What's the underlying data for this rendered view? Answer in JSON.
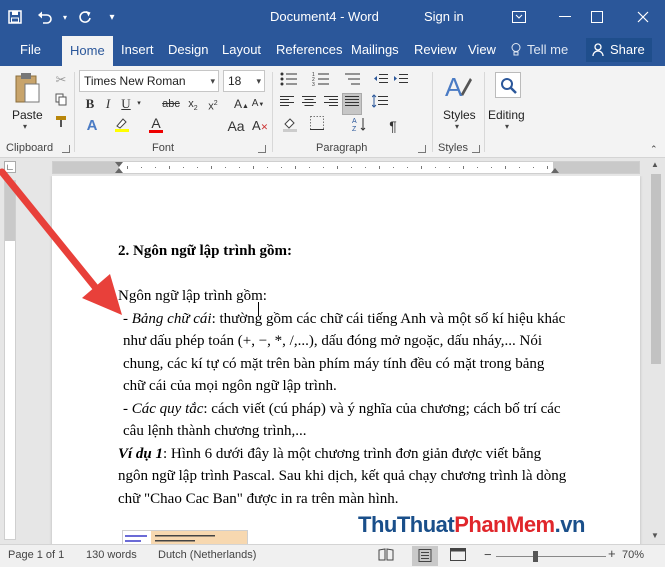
{
  "titlebar": {
    "title": "Document4 - Word",
    "signin": "Sign in",
    "save_icon": "save-icon",
    "undo_icon": "undo-icon",
    "redo_icon": "redo-icon",
    "customize_icon": "customize-qat-icon"
  },
  "tabs": [
    {
      "label": "File"
    },
    {
      "label": "Home"
    },
    {
      "label": "Insert"
    },
    {
      "label": "Design"
    },
    {
      "label": "Layout"
    },
    {
      "label": "References"
    },
    {
      "label": "Mailings"
    },
    {
      "label": "Review"
    },
    {
      "label": "View"
    }
  ],
  "tellme": "Tell me",
  "share": "Share",
  "ribbon": {
    "clipboard": {
      "label": "Clipboard",
      "paste": "Paste"
    },
    "font": {
      "label": "Font",
      "family": "Times New Roman",
      "size": "18"
    },
    "paragraph": {
      "label": "Paragraph"
    },
    "styles": {
      "label": "Styles",
      "styles_btn": "Styles"
    },
    "editing": {
      "label": "Editing"
    }
  },
  "document": {
    "heading": "2. Ngôn ngữ lập trình gồm:",
    "intro": "Ngôn ngữ lập trình gồm:",
    "bullet1_italic": "- Bảng chữ cái",
    "bullet1_rest": ": thường gồm các chữ cái tiếng Anh và một số kí hiệu khác như dấu phép toán (+, −, *, /,...), dấu đóng mở ngoặc, dấu nháy,... Nói chung, các kí tự có mặt trên bàn phím máy tính đều có mặt trong bảng chữ cái của mọi ngôn ngữ lập trình.",
    "bullet2_italic": "- Các quy tắc",
    "bullet2_rest": ": cách viết (cú pháp) và ý nghĩa của chương; cách bố trí các câu lệnh thành chương trình,...",
    "example_label": "Ví dụ 1",
    "example_rest": ": Hình 6 dưới đây là một chương trình đơn giản được viết bằng ngôn ngữ lập trình Pascal. Sau khi dịch, kết quả chạy chương trình là dòng chữ \"Chao Cac Ban\" được in ra trên màn hình."
  },
  "statusbar": {
    "page": "Page 1 of 1",
    "words": "130 words",
    "language": "Dutch (Netherlands)",
    "zoom": "70%",
    "zoom_level": 0.35
  },
  "watermark": {
    "part1": "ThuThuat",
    "part2": "PhanMem",
    "part3": ".vn"
  },
  "colors": {
    "word_blue": "#2b579a",
    "arrow_red": "#e8403a",
    "watermark_dark": "#1a4f8a",
    "watermark_red": "#e0262b"
  }
}
